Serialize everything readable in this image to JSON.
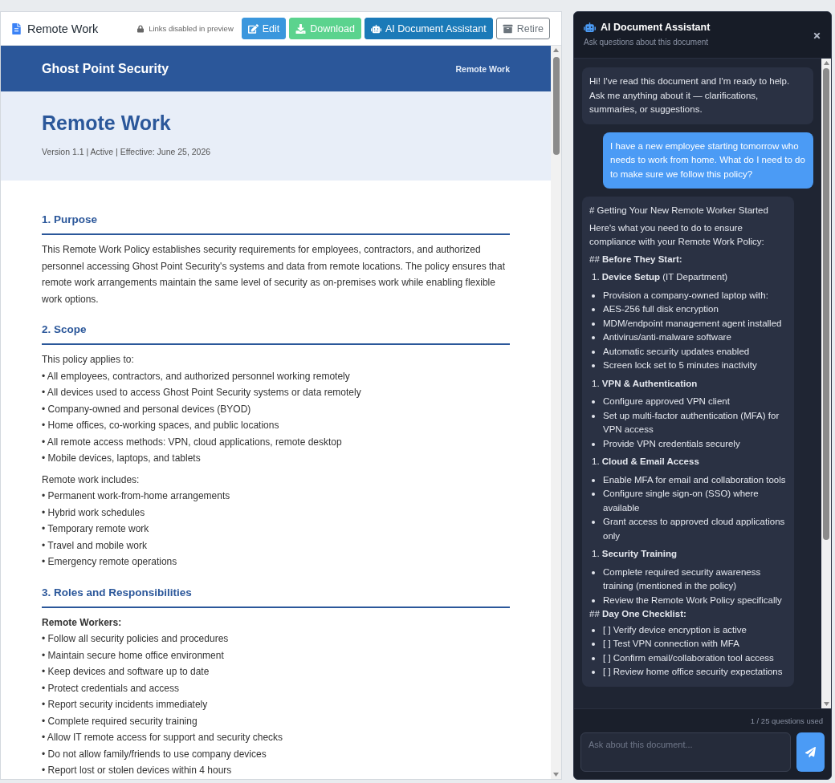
{
  "toolbar": {
    "title": "Remote Work",
    "notice": "Links disabled in preview",
    "buttons": [
      {
        "kind": "edit",
        "label": "Edit"
      },
      {
        "kind": "download",
        "label": "Download"
      },
      {
        "kind": "assistant",
        "label": "AI Document Assistant"
      },
      {
        "kind": "retire",
        "label": "Retire"
      }
    ]
  },
  "document": {
    "banner": {
      "org": "Ghost Point Security",
      "doc_label": "Remote Work"
    },
    "title": "Remote Work",
    "meta": "Version 1.1 | Active | Effective: June 25, 2026",
    "sections": [
      {
        "heading": "1. Purpose",
        "blocks": [
          {
            "kind": "paragraph",
            "text": "This Remote Work Policy establishes security requirements for employees, contractors, and authorized personnel accessing Ghost Point Security's systems and data from remote locations. The policy ensures that remote work arrangements maintain the same level of security as on-premises work while enabling flexible work options."
          }
        ]
      },
      {
        "heading": "2. Scope",
        "blocks": [
          {
            "kind": "intro",
            "text": "This policy applies to:"
          },
          {
            "kind": "bullet",
            "text": "• All employees, contractors, and authorized personnel working remotely"
          },
          {
            "kind": "bullet",
            "text": "• All devices used to access Ghost Point Security systems or data remotely"
          },
          {
            "kind": "bullet",
            "text": "• Company-owned and personal devices (BYOD)"
          },
          {
            "kind": "bullet",
            "text": "• Home offices, co-working spaces, and public locations"
          },
          {
            "kind": "bullet",
            "text": "• All remote access methods: VPN, cloud applications, remote desktop"
          },
          {
            "kind": "bullet",
            "text": "• Mobile devices, laptops, and tablets"
          },
          {
            "kind": "intro",
            "text": "Remote work includes:"
          },
          {
            "kind": "bullet",
            "text": "• Permanent work-from-home arrangements"
          },
          {
            "kind": "bullet",
            "text": "• Hybrid work schedules"
          },
          {
            "kind": "bullet",
            "text": "• Temporary remote work"
          },
          {
            "kind": "bullet",
            "text": "• Travel and mobile work"
          },
          {
            "kind": "bullet",
            "text": "• Emergency remote operations"
          }
        ]
      },
      {
        "heading": "3. Roles and Responsibilities",
        "blocks": [
          {
            "kind": "subhead",
            "text": "Remote Workers:"
          },
          {
            "kind": "bullet",
            "text": "• Follow all security policies and procedures"
          },
          {
            "kind": "bullet",
            "text": "• Maintain secure home office environment"
          },
          {
            "kind": "bullet",
            "text": "• Keep devices and software up to date"
          },
          {
            "kind": "bullet",
            "text": "• Protect credentials and access"
          },
          {
            "kind": "bullet",
            "text": "• Report security incidents immediately"
          },
          {
            "kind": "bullet",
            "text": "• Complete required security training"
          },
          {
            "kind": "bullet",
            "text": "• Allow IT remote access for support and security checks"
          },
          {
            "kind": "bullet",
            "text": "• Do not allow family/friends to use company devices"
          },
          {
            "kind": "bullet",
            "text": "• Report lost or stolen devices within 4 hours"
          }
        ]
      }
    ]
  },
  "assistant": {
    "title": "AI Document Assistant",
    "subtitle": "Ask questions about this document",
    "messages": [
      {
        "kind": "assistant",
        "text": "Hi! I've read this document and I'm ready to help. Ask me anything about it — clarifications, summaries, or suggestions."
      },
      {
        "kind": "user",
        "text": "I have a new employee starting tomorrow who needs to work from home. What do I need to do to make sure we follow this policy?"
      },
      {
        "kind": "assistant",
        "blocks": [
          {
            "kind": "text",
            "text": "# Getting Your New Remote Worker Started"
          },
          {
            "kind": "text",
            "text": "Here's what you need to do to ensure compliance with your Remote Work Policy:"
          },
          {
            "kind": "subheading",
            "text": "## **Before They Start:**"
          },
          {
            "kind": "step",
            "text": "1. **Device Setup** (IT Department)"
          },
          {
            "kind": "bullet",
            "text": "Provision a company-owned laptop with:"
          },
          {
            "kind": "bullet",
            "text": "AES-256 full disk encryption"
          },
          {
            "kind": "bullet",
            "text": "MDM/endpoint management agent installed"
          },
          {
            "kind": "bullet",
            "text": "Antivirus/anti-malware software"
          },
          {
            "kind": "bullet",
            "text": "Automatic security updates enabled"
          },
          {
            "kind": "bullet",
            "text": "Screen lock set to 5 minutes inactivity"
          },
          {
            "kind": "step",
            "text": "1. **VPN & Authentication**"
          },
          {
            "kind": "bullet",
            "text": "Configure approved VPN client"
          },
          {
            "kind": "bullet",
            "text": "Set up multi-factor authentication (MFA) for VPN access"
          },
          {
            "kind": "bullet",
            "text": "Provide VPN credentials securely"
          },
          {
            "kind": "step",
            "text": "1. **Cloud & Email Access**"
          },
          {
            "kind": "bullet",
            "text": "Enable MFA for email and collaboration tools"
          },
          {
            "kind": "bullet",
            "text": "Configure single sign-on (SSO) where available"
          },
          {
            "kind": "bullet",
            "text": "Grant access to approved cloud applications only"
          },
          {
            "kind": "step",
            "text": "1. **Security Training**"
          },
          {
            "kind": "bullet",
            "text": "Complete required security awareness training (mentioned in the policy)"
          },
          {
            "kind": "bullet",
            "text": "Review the Remote Work Policy specifically"
          },
          {
            "kind": "subheading",
            "text": "## **Day One Checklist:**"
          },
          {
            "kind": "bullet",
            "text": "[ ] Verify device encryption is active"
          },
          {
            "kind": "bullet",
            "text": "[ ] Test VPN connection with MFA"
          },
          {
            "kind": "bullet",
            "text": "[ ] Confirm email/collaboration tool access"
          },
          {
            "kind": "bullet",
            "text": "[ ] Review home office security expectations"
          }
        ]
      }
    ],
    "usage": "1 / 25 questions used",
    "input": {
      "placeholder": "Ask about this document..."
    }
  }
}
